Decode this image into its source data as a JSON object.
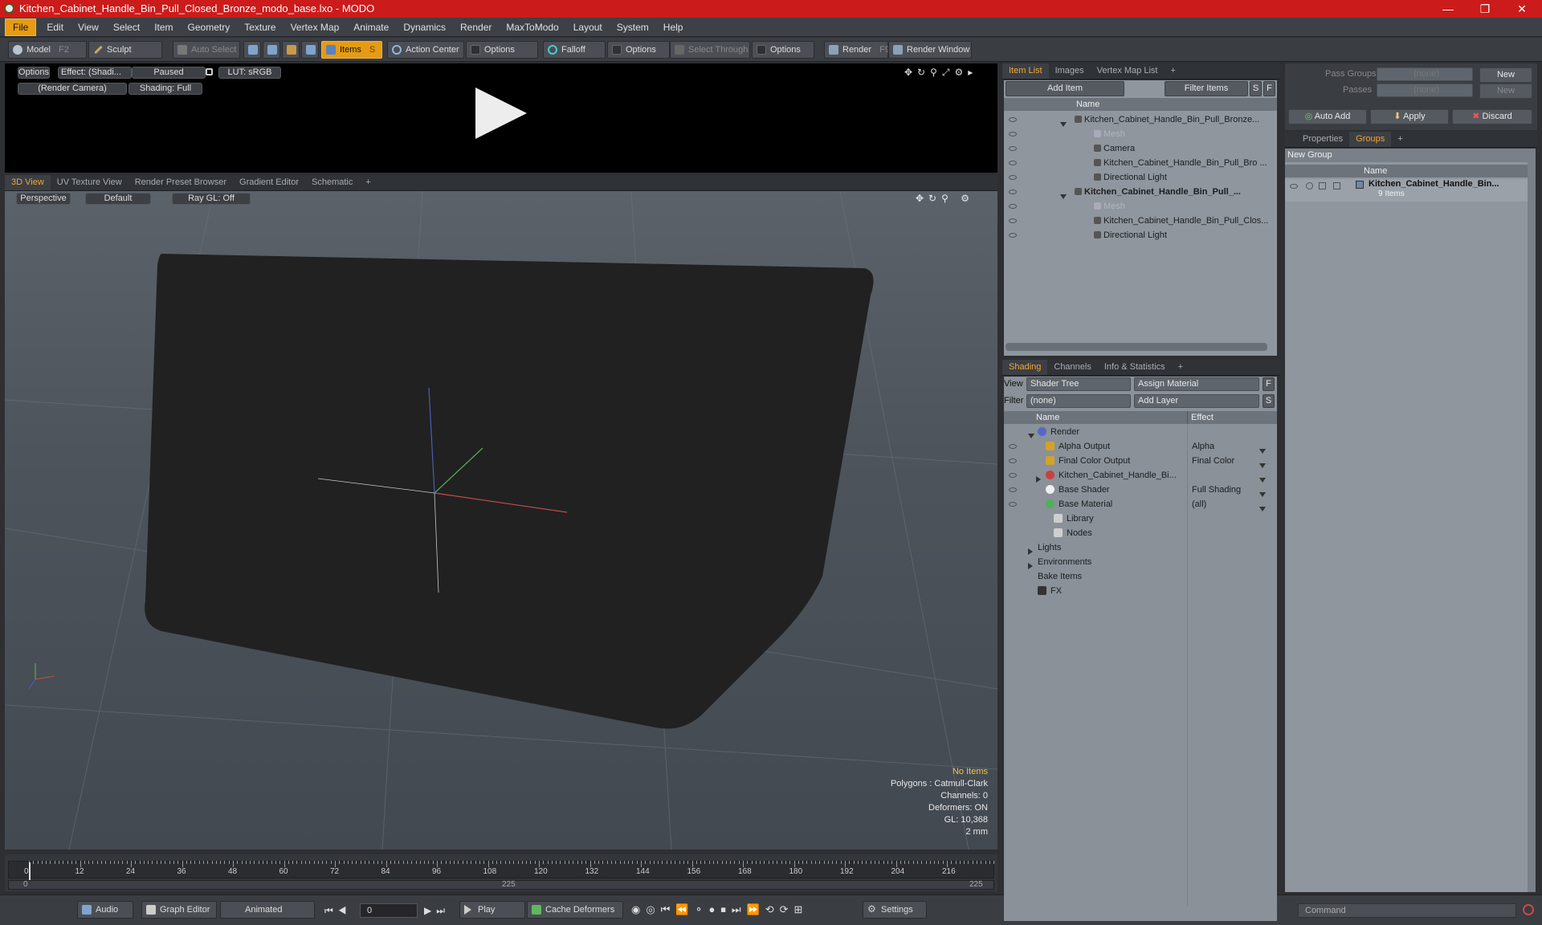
{
  "title_bar": {
    "title": "Kitchen_Cabinet_Handle_Bin_Pull_Closed_Bronze_modo_base.lxo - MODO",
    "minimize": "—",
    "restore": "❐",
    "close": "✕"
  },
  "menu": [
    "File",
    "Edit",
    "View",
    "Select",
    "Item",
    "Geometry",
    "Texture",
    "Vertex Map",
    "Animate",
    "Dynamics",
    "Render",
    "MaxToModo",
    "Layout",
    "System",
    "Help"
  ],
  "toolbar": {
    "model": "Model",
    "model_key": "F2",
    "sculpt": "Sculpt",
    "auto_select": "Auto Select",
    "items": "Items",
    "items_key": "S",
    "action_center": "Action Center",
    "options1": "Options",
    "falloff": "Falloff",
    "options2": "Options",
    "select_through": "Select Through",
    "options3": "Options",
    "render": "Render",
    "render_key": "F9",
    "render_window": "Render Window"
  },
  "preview": {
    "options": "Options",
    "effect": "Effect: (Shadi...",
    "paused": "Paused",
    "lut": "LUT: sRGB",
    "camera": "(Render Camera)",
    "shading": "Shading: Full"
  },
  "viewport_tabs": [
    "3D View",
    "UV Texture View",
    "Render Preset Browser",
    "Gradient Editor",
    "Schematic",
    "+"
  ],
  "viewport": {
    "perspective": "Perspective",
    "default": "Default",
    "raygl": "Ray GL: Off"
  },
  "hud": {
    "no_items": "No Items",
    "polygons": "Polygons : Catmull-Clark",
    "channels": "Channels: 0",
    "deformers": "Deformers: ON",
    "gl": "GL: 10,368",
    "unit": "2 mm"
  },
  "timeline": {
    "ticks": [
      "0",
      "12",
      "24",
      "36",
      "48",
      "60",
      "72",
      "84",
      "96",
      "108",
      "120",
      "132",
      "144",
      "156",
      "168",
      "180",
      "192",
      "204",
      "216"
    ],
    "start": "0",
    "mid": "225",
    "end": "225"
  },
  "bottombar": {
    "audio": "Audio",
    "graph_editor": "Graph Editor",
    "animated": "Animated",
    "frame": "0",
    "play": "Play",
    "cache_deformers": "Cache Deformers",
    "settings": "Settings",
    "command": "Command"
  },
  "item_list": {
    "tabs": [
      "Item List",
      "Images",
      "Vertex Map List",
      "+"
    ],
    "add_item": "Add Item",
    "filter_items": "Filter Items",
    "s": "S",
    "f": "F",
    "col_name": "Name",
    "rows": [
      {
        "label": "Kitchen_Cabinet_Handle_Bin_Pull_Bronze...",
        "indent": 0,
        "bold": false,
        "dim": false
      },
      {
        "label": "Mesh",
        "indent": 1,
        "bold": false,
        "dim": true
      },
      {
        "label": "Camera",
        "indent": 1,
        "bold": false,
        "dim": false
      },
      {
        "label": "Kitchen_Cabinet_Handle_Bin_Pull_Bro ...",
        "indent": 1,
        "bold": false,
        "dim": false
      },
      {
        "label": "Directional Light",
        "indent": 1,
        "bold": false,
        "dim": false
      },
      {
        "label": "Kitchen_Cabinet_Handle_Bin_Pull_...",
        "indent": 0,
        "bold": true,
        "dim": false
      },
      {
        "label": "Mesh",
        "indent": 1,
        "bold": false,
        "dim": true
      },
      {
        "label": "Kitchen_Cabinet_Handle_Bin_Pull_Clos...",
        "indent": 1,
        "bold": false,
        "dim": false
      },
      {
        "label": "Directional Light",
        "indent": 1,
        "bold": false,
        "dim": false
      }
    ]
  },
  "shading": {
    "tabs": [
      "Shading",
      "Channels",
      "Info & Statistics",
      "+"
    ],
    "view_label": "View",
    "view_value": "Shader Tree",
    "assign_material": "Assign Material",
    "filter_label": "Filter",
    "filter_value": "(none)",
    "add_layer": "Add Layer",
    "f": "F",
    "s": "S",
    "col_name": "Name",
    "col_effect": "Effect",
    "rows": [
      {
        "label": "Render",
        "effect": "",
        "icon": "render-sphere-icon"
      },
      {
        "label": "Alpha Output",
        "effect": "Alpha",
        "icon": "output-icon"
      },
      {
        "label": "Final Color Output",
        "effect": "Final Color",
        "icon": "output-icon"
      },
      {
        "label": "Kitchen_Cabinet_Handle_Bi...",
        "effect": "",
        "icon": "material-group-icon"
      },
      {
        "label": "Base Shader",
        "effect": "Full Shading",
        "icon": "shader-icon"
      },
      {
        "label": "Base Material",
        "effect": "(all)",
        "icon": "material-icon"
      },
      {
        "label": "Library",
        "effect": "",
        "icon": "folder-icon"
      },
      {
        "label": "Nodes",
        "effect": "",
        "icon": "folder-icon"
      },
      {
        "label": "Lights",
        "effect": "",
        "icon": ""
      },
      {
        "label": "Environments",
        "effect": "",
        "icon": ""
      },
      {
        "label": "Bake Items",
        "effect": "",
        "icon": ""
      },
      {
        "label": "FX",
        "effect": "",
        "icon": "fx-icon"
      }
    ]
  },
  "groups": {
    "pass_groups_label": "Pass Groups",
    "pass_groups_value": "(none)",
    "passes_label": "Passes",
    "passes_value": "(none)",
    "new": "New",
    "new2": "New",
    "auto_add": "Auto Add",
    "apply": "Apply",
    "discard": "Discard",
    "tabs": [
      "Properties",
      "Groups",
      "+"
    ],
    "new_group": "New Group",
    "col_name": "Name",
    "group_name": "Kitchen_Cabinet_Handle_Bin...",
    "group_count": "9 Items"
  },
  "colors": {
    "accent": "#e69b14",
    "titlebar": "#cc1b1b"
  }
}
